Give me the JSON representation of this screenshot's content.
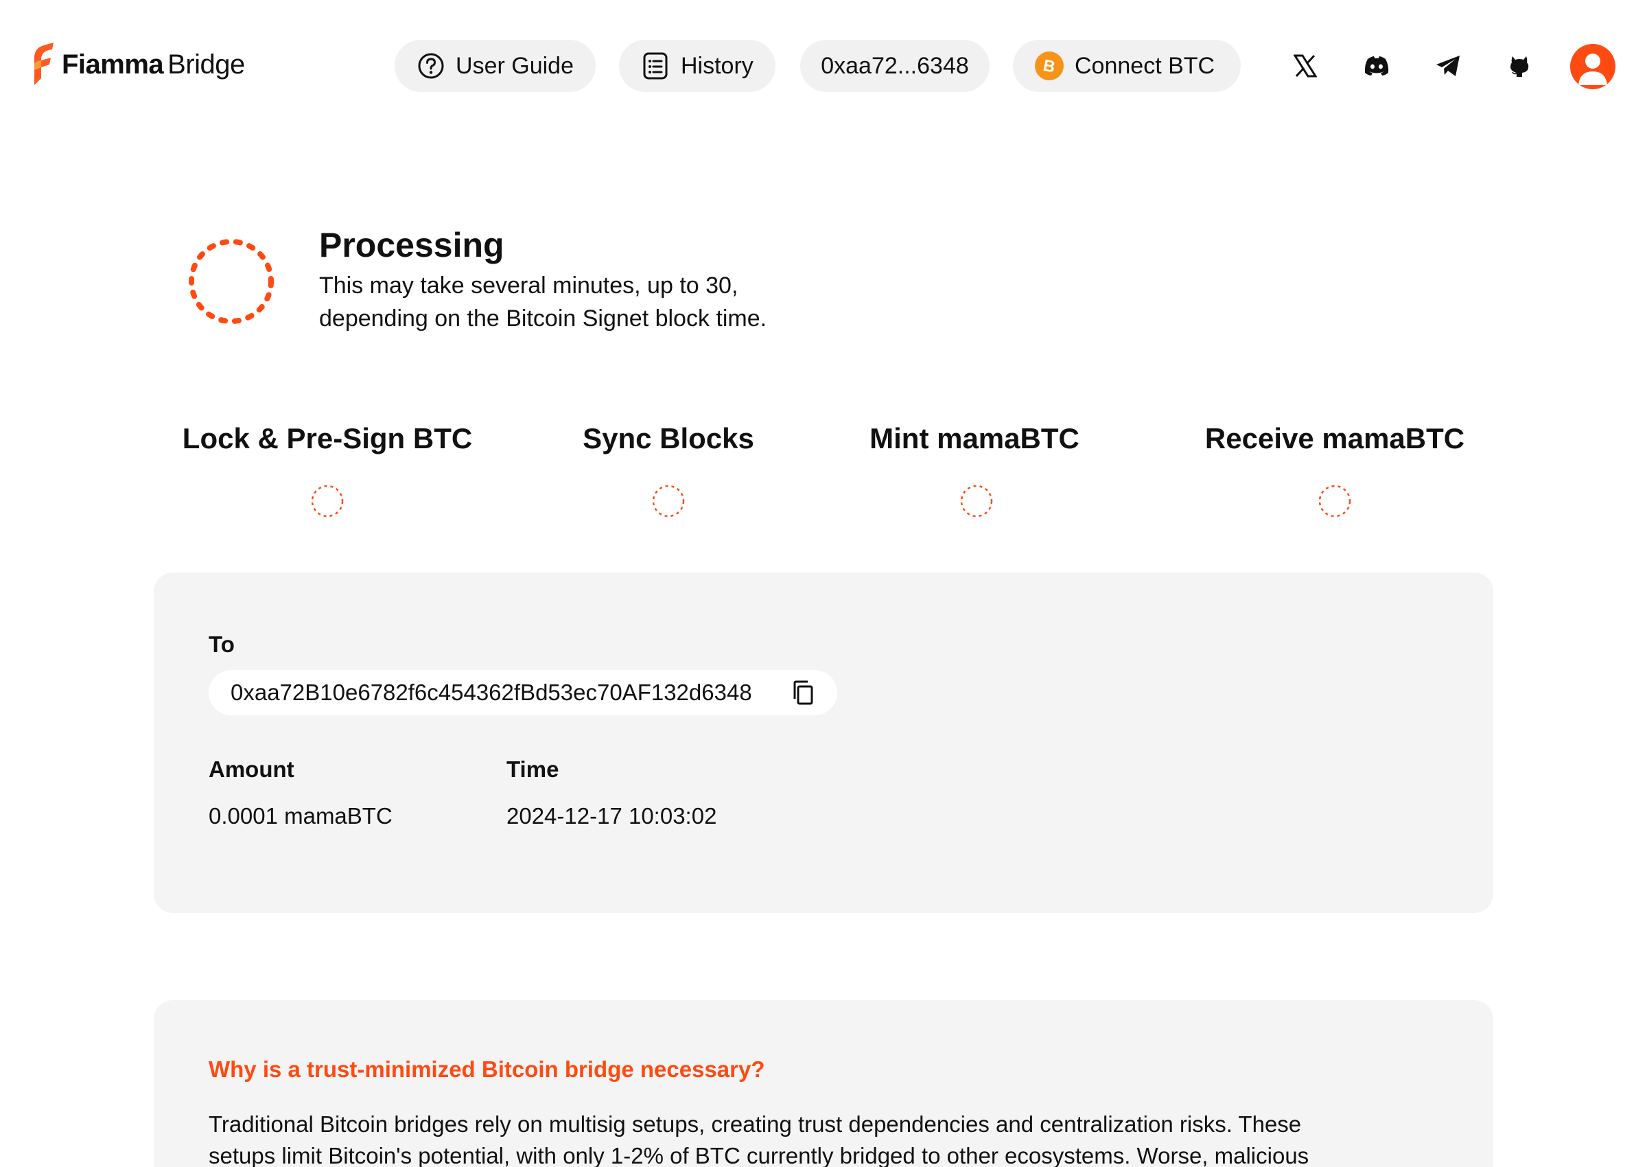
{
  "brand": {
    "name_bold": "Fiamma",
    "name_light": "Bridge",
    "accent_color": "#ff4a12",
    "btc_color": "#f7931a"
  },
  "header": {
    "user_guide": {
      "label": "User Guide",
      "icon": "question-circle-icon"
    },
    "history": {
      "label": "History",
      "icon": "list-doc-icon"
    },
    "wallet_address": "0xaa72...6348",
    "connect_btc": {
      "label": "Connect BTC",
      "icon": "bitcoin-icon"
    },
    "socials": [
      "x-icon",
      "discord-icon",
      "telegram-icon",
      "github-icon"
    ],
    "avatar_icon": "user-avatar-icon"
  },
  "status": {
    "title": "Processing",
    "line1": "This may take several minutes, up to 30,",
    "line2": "depending on the Bitcoin Signet block time."
  },
  "steps": [
    {
      "label": "Lock & Pre-Sign BTC"
    },
    {
      "label": "Sync Blocks"
    },
    {
      "label": "Mint mamaBTC"
    },
    {
      "label": "Receive mamaBTC"
    }
  ],
  "details": {
    "to_label": "To",
    "to_address": "0xaa72B10e6782f6c454362fBd53ec70AF132d6348",
    "amount_label": "Amount",
    "amount_value": "0.0001 mamaBTC",
    "time_label": "Time",
    "time_value": "2024-12-17 10:03:02"
  },
  "info": {
    "question": "Why is a trust-minimized Bitcoin bridge necessary?",
    "line1": "Traditional Bitcoin bridges rely on multisig setups, creating trust dependencies and centralization risks. These",
    "line2": "setups limit Bitcoin's potential, with only 1-2% of BTC currently bridged to other ecosystems. Worse, malicious"
  }
}
